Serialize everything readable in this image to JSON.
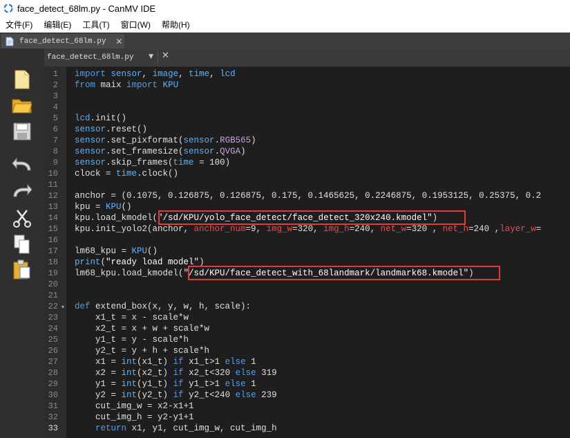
{
  "window": {
    "title": "face_detect_68lm.py - CanMV IDE"
  },
  "menu": [
    "文件(F)",
    "编辑(E)",
    "工具(T)",
    "窗口(W)",
    "帮助(H)"
  ],
  "file_tab": {
    "label": "face_detect_68lm.py"
  },
  "editor_header": {
    "document": "face_detect_68lm.py"
  },
  "toolbar": [
    "new-file-icon",
    "open-folder-icon",
    "save-icon",
    "undo-icon",
    "redo-icon",
    "cut-icon",
    "copy-icon",
    "paste-icon"
  ],
  "colors": {
    "keyword": "#45a1ff",
    "accent": "#f0a030",
    "argument": "#f04848",
    "highlight_box": "#e53935"
  },
  "editor": {
    "current_line": 33,
    "line_numbers": [
      "1",
      "2",
      "3",
      "4",
      "5",
      "6",
      "7",
      "8",
      "9",
      "10",
      "11",
      "12",
      "13",
      "14",
      "15",
      "16",
      "17",
      "18",
      "19",
      "20",
      "21",
      "22",
      "23",
      "24",
      "25",
      "26",
      "27",
      "28",
      "29",
      "30",
      "31",
      "32",
      "33"
    ],
    "lines": [
      "import sensor, image, time, lcd",
      "from maix import KPU",
      "",
      "",
      "lcd.init()",
      "sensor.reset()",
      "sensor.set_pixformat(sensor.RGB565)",
      "sensor.set_framesize(sensor.QVGA)",
      "sensor.skip_frames(time = 100)",
      "clock = time.clock()",
      "",
      "anchor = (0.1075, 0.126875, 0.126875, 0.175, 0.1465625, 0.2246875, 0.1953125, 0.25375, 0.2",
      "kpu = KPU()",
      "kpu.load_kmodel(\"/sd/KPU/yolo_face_detect/face_detect_320x240.kmodel\")",
      "kpu.init_yolo2(anchor, anchor_num=9, img_w=320, img_h=240, net_w=320 , net_h=240 ,layer_w=",
      "",
      "lm68_kpu = KPU()",
      "print(\"ready load model\")",
      "lm68_kpu.load_kmodel(\"/sd/KPU/face_detect_with_68landmark/landmark68.kmodel\")",
      "",
      "",
      "def extend_box(x, y, w, h, scale):",
      "    x1_t = x - scale*w",
      "    x2_t = x + w + scale*w",
      "    y1_t = y - scale*h",
      "    y2_t = y + h + scale*h",
      "    x1 = int(x1_t) if x1_t>1 else 1",
      "    x2 = int(x2_t) if x2_t<320 else 319",
      "    y1 = int(y1_t) if y1_t>1 else 1",
      "    y2 = int(y2_t) if y2_t<240 else 239",
      "    cut_img_w = x2-x1+1",
      "    cut_img_h = y2-y1+1",
      "    return x1, y1, cut_img_w, cut_img_h"
    ]
  }
}
